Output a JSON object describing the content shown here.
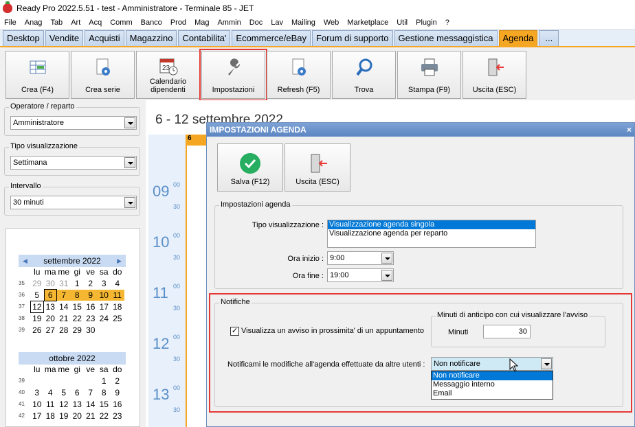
{
  "window": {
    "title": "Ready Pro 2022.5.51 - test - Amministratore - Terminale 85 - JET"
  },
  "menu": [
    "File",
    "Anag",
    "Tab",
    "Art",
    "Acq",
    "Comm",
    "Banco",
    "Prod",
    "Mag",
    "Ammin",
    "Doc",
    "Lav",
    "Mailing",
    "Web",
    "Marketplace",
    "Util",
    "Plugin",
    "?"
  ],
  "tabs": [
    "Desktop",
    "Vendite",
    "Acquisti",
    "Magazzino",
    "Contabilita'",
    "Ecommerce/eBay",
    "Forum di supporto",
    "Gestione messaggistica",
    "Agenda",
    "..."
  ],
  "active_tab": "Agenda",
  "toolbar": {
    "crea": "Crea (F4)",
    "crea_serie": "Crea serie",
    "calendario": "Calendario dipendenti",
    "impostazioni": "Impostazioni",
    "refresh": "Refresh (F5)",
    "trova": "Trova",
    "stampa": "Stampa (F9)",
    "uscita": "Uscita (ESC)"
  },
  "left": {
    "operatore_label": "Operatore / reparto",
    "operatore_value": "Amministratore",
    "tipo_label": "Tipo visualizzazione",
    "tipo_value": "Settimana",
    "intervallo_label": "Intervallo",
    "intervallo_value": "30 minuti"
  },
  "calendar_sept": {
    "title": "settembre 2022",
    "dows": [
      "lu",
      "ma",
      "me",
      "gi",
      "ve",
      "sa",
      "do"
    ],
    "weeks": [
      {
        "wk": "35",
        "days": [
          "29",
          "30",
          "31",
          "1",
          "2",
          "3",
          "4"
        ]
      },
      {
        "wk": "36",
        "days": [
          "5",
          "6",
          "7",
          "8",
          "9",
          "10",
          "11"
        ]
      },
      {
        "wk": "37",
        "days": [
          "12",
          "13",
          "14",
          "15",
          "16",
          "17",
          "18"
        ]
      },
      {
        "wk": "38",
        "days": [
          "19",
          "20",
          "21",
          "22",
          "23",
          "24",
          "25"
        ]
      },
      {
        "wk": "39",
        "days": [
          "26",
          "27",
          "28",
          "29",
          "30",
          "",
          ""
        ]
      }
    ]
  },
  "calendar_oct": {
    "title": "ottobre 2022",
    "dows": [
      "lu",
      "ma",
      "me",
      "gi",
      "ve",
      "sa",
      "do"
    ],
    "weeks": [
      {
        "wk": "39",
        "days": [
          "",
          "",
          "",
          "",
          "",
          "1",
          "2"
        ]
      },
      {
        "wk": "40",
        "days": [
          "3",
          "4",
          "5",
          "6",
          "7",
          "8",
          "9"
        ]
      },
      {
        "wk": "41",
        "days": [
          "10",
          "11",
          "12",
          "13",
          "14",
          "15",
          "16"
        ]
      },
      {
        "wk": "42",
        "days": [
          "17",
          "18",
          "19",
          "20",
          "21",
          "22",
          "23"
        ]
      }
    ]
  },
  "agenda": {
    "range": "6 - 12 settembre 2022",
    "day_header": "6",
    "hours": [
      "09",
      "10",
      "11",
      "12",
      "13"
    ],
    "minute_00": "00",
    "minute_30": "30"
  },
  "dialog": {
    "title": "IMPOSTAZIONI AGENDA",
    "close": "×",
    "salva": "Salva (F12)",
    "uscita": "Uscita (ESC)",
    "impostazioni_group": "Impostazioni agenda",
    "tipo_label": "Tipo visualizzazione :",
    "tipo_options": [
      "Visualizzazione agenda singola",
      "Visualizzazione agenda per reparto"
    ],
    "ora_inizio_label": "Ora inizio :",
    "ora_inizio": "9:00",
    "ora_fine_label": "Ora fine :",
    "ora_fine": "19:00",
    "notifiche_group": "Notifiche",
    "avviso_label": "Visualizza un avviso in prossimita' di un appuntamento",
    "avviso_checked": "✓",
    "anticipo_group": "Minuti di anticipo con cui visualizzare l'avviso",
    "minuti_label": "Minuti",
    "minuti_value": "30",
    "notificami_label": "Notificami le modifiche all'agenda effettuate da altre utenti :",
    "notificami_value": "Non notificare",
    "notificami_options": [
      "Non notificare",
      "Messaggio interno",
      "Email"
    ]
  },
  "colors": {
    "accent": "#f5a623",
    "highlight_red": "#e53935",
    "selection": "#0078d7"
  }
}
